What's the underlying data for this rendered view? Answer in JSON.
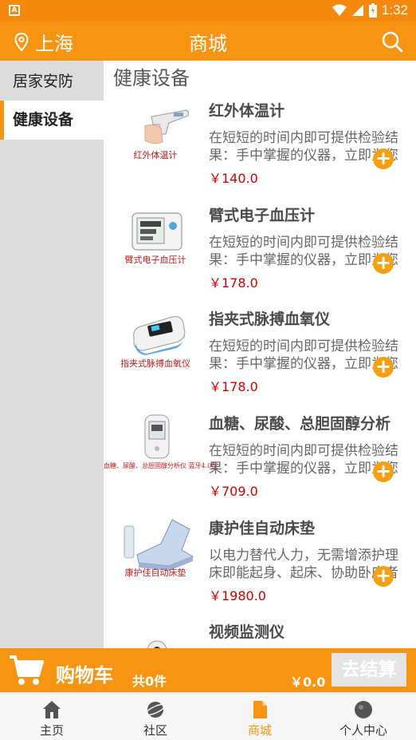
{
  "status_bar": {
    "time": "1:32",
    "notification_icon": "a-notification-icon"
  },
  "header": {
    "city": "上海",
    "title": "商城",
    "search_icon": "search-icon"
  },
  "sidebar": {
    "items": [
      {
        "label": "居家安防",
        "active": false
      },
      {
        "label": "健康设备",
        "active": true
      }
    ]
  },
  "section": {
    "title": "健康设备"
  },
  "products": [
    {
      "name": "红外体温计",
      "image_caption": "红外体温计",
      "desc": "在短短的时间内即可提供检验结果：手中掌握的仪器，立即为您",
      "price": "￥140.0"
    },
    {
      "name": "臂式电子血压计",
      "image_caption": "臂式电子血压计",
      "desc": "在短短的时间内即可提供检验结果：手中掌握的仪器，立即为您",
      "price": "￥178.0"
    },
    {
      "name": "指夹式脉搏血氧仪",
      "image_caption": "指夹式脉搏血氧仪",
      "desc": "在短短的时间内即可提供检验结果：手中掌握的仪器，立即为您",
      "price": "￥178.0"
    },
    {
      "name": "血糖、尿酸、总胆固醇分析",
      "image_caption": "血糖、尿酸、总胆固醇分析仪 蓝牙4.0型",
      "desc": "在短短的时间内即可提供检验结果：手中掌握的仪器，立即为您",
      "price": "￥709.0"
    },
    {
      "name": "康护佳自动床垫",
      "image_caption": "康护佳自动床垫",
      "desc": "以电力替代人力，无需增添护理床即能起身、起床、协助卧床者",
      "price": "￥1980.0"
    },
    {
      "name": "视频监测仪",
      "image_caption": "",
      "desc": "",
      "price": ""
    }
  ],
  "cart": {
    "label": "购物车",
    "count": "共0件",
    "total": "￥0.0",
    "checkout": "去结算"
  },
  "bottom_nav": {
    "items": [
      {
        "label": "主页",
        "icon": "home-icon"
      },
      {
        "label": "社区",
        "icon": "community-icon"
      },
      {
        "label": "商城",
        "icon": "shop-icon",
        "active": true
      },
      {
        "label": "个人中心",
        "icon": "profile-icon"
      }
    ]
  },
  "colors": {
    "accent": "#f79411",
    "price": "#d10000",
    "sidebar_bg": "#dcdcdc",
    "add_button": "#f5a012"
  }
}
